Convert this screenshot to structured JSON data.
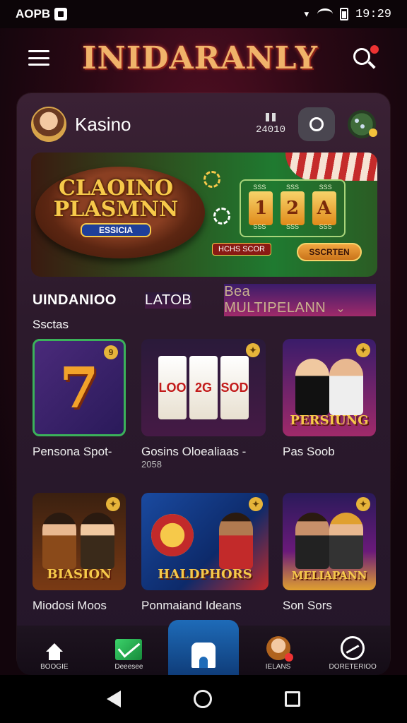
{
  "status_bar": {
    "left_text": "AOPB",
    "time": "19:29",
    "signal_icon": "signal-icon",
    "wifi_icon": "wifi-icon",
    "battery_icon": "battery-icon"
  },
  "app_header": {
    "title": "INIDARANLY",
    "menu_icon": "hamburger-icon",
    "search_icon": "search-icon"
  },
  "panel": {
    "user_name": "Kasino",
    "stat_value": "24010",
    "search_button_icon": "search-icon",
    "chip_icon": "chip-icon"
  },
  "banner": {
    "title_line1": "CLAOINO",
    "title_line2": "PLASMNN",
    "subtitle": "ESSICIA",
    "card_labels_top": [
      "SSS",
      "SSS",
      "SSS"
    ],
    "card_labels_bottom": [
      "SSS",
      "SSS",
      "SSS"
    ],
    "cards": [
      "1",
      "2",
      "A"
    ],
    "tag": "HCHS SCOR",
    "cta": "SSCRTEN"
  },
  "tabs": [
    {
      "label": "UINDANIOO"
    },
    {
      "label": "LATOB"
    },
    {
      "label": "Bea MULTIPELANN"
    }
  ],
  "section_label": "Ssctas",
  "games": [
    {
      "title": "Pensona Spot-",
      "sub": "",
      "art": "7",
      "thumb_text": ""
    },
    {
      "title": "Gosins Oloealiaas -",
      "sub": "2058",
      "art": "",
      "thumb_text": ""
    },
    {
      "title": "Pas Soob",
      "sub": "",
      "art": "",
      "thumb_text": "PERSIUNG"
    },
    {
      "title": "Miodosi Moos",
      "sub": "",
      "art": "",
      "thumb_text": "BIASION"
    },
    {
      "title": "Ponmaiand Ideans",
      "sub": "",
      "art": "",
      "thumb_text": "HALDPHORS"
    },
    {
      "title": "Son Sors",
      "sub": "",
      "art": "",
      "thumb_text": "MELIAPANN"
    }
  ],
  "reels": [
    "LOO",
    "2G",
    "SOD"
  ],
  "bottom_nav": [
    {
      "label": "BOOGIE",
      "icon": "home-icon"
    },
    {
      "label": "Deeesee",
      "icon": "mail-icon"
    },
    {
      "label": "",
      "icon": "home-active-icon"
    },
    {
      "label": "IELANS",
      "icon": "profile-icon"
    },
    {
      "label": "DORETERIOO",
      "icon": "gauge-icon"
    }
  ],
  "colors": {
    "accent_gold": "#f6c94a",
    "panel_bg": "#2c1a2c",
    "nav_active": "#1e6bb8"
  }
}
